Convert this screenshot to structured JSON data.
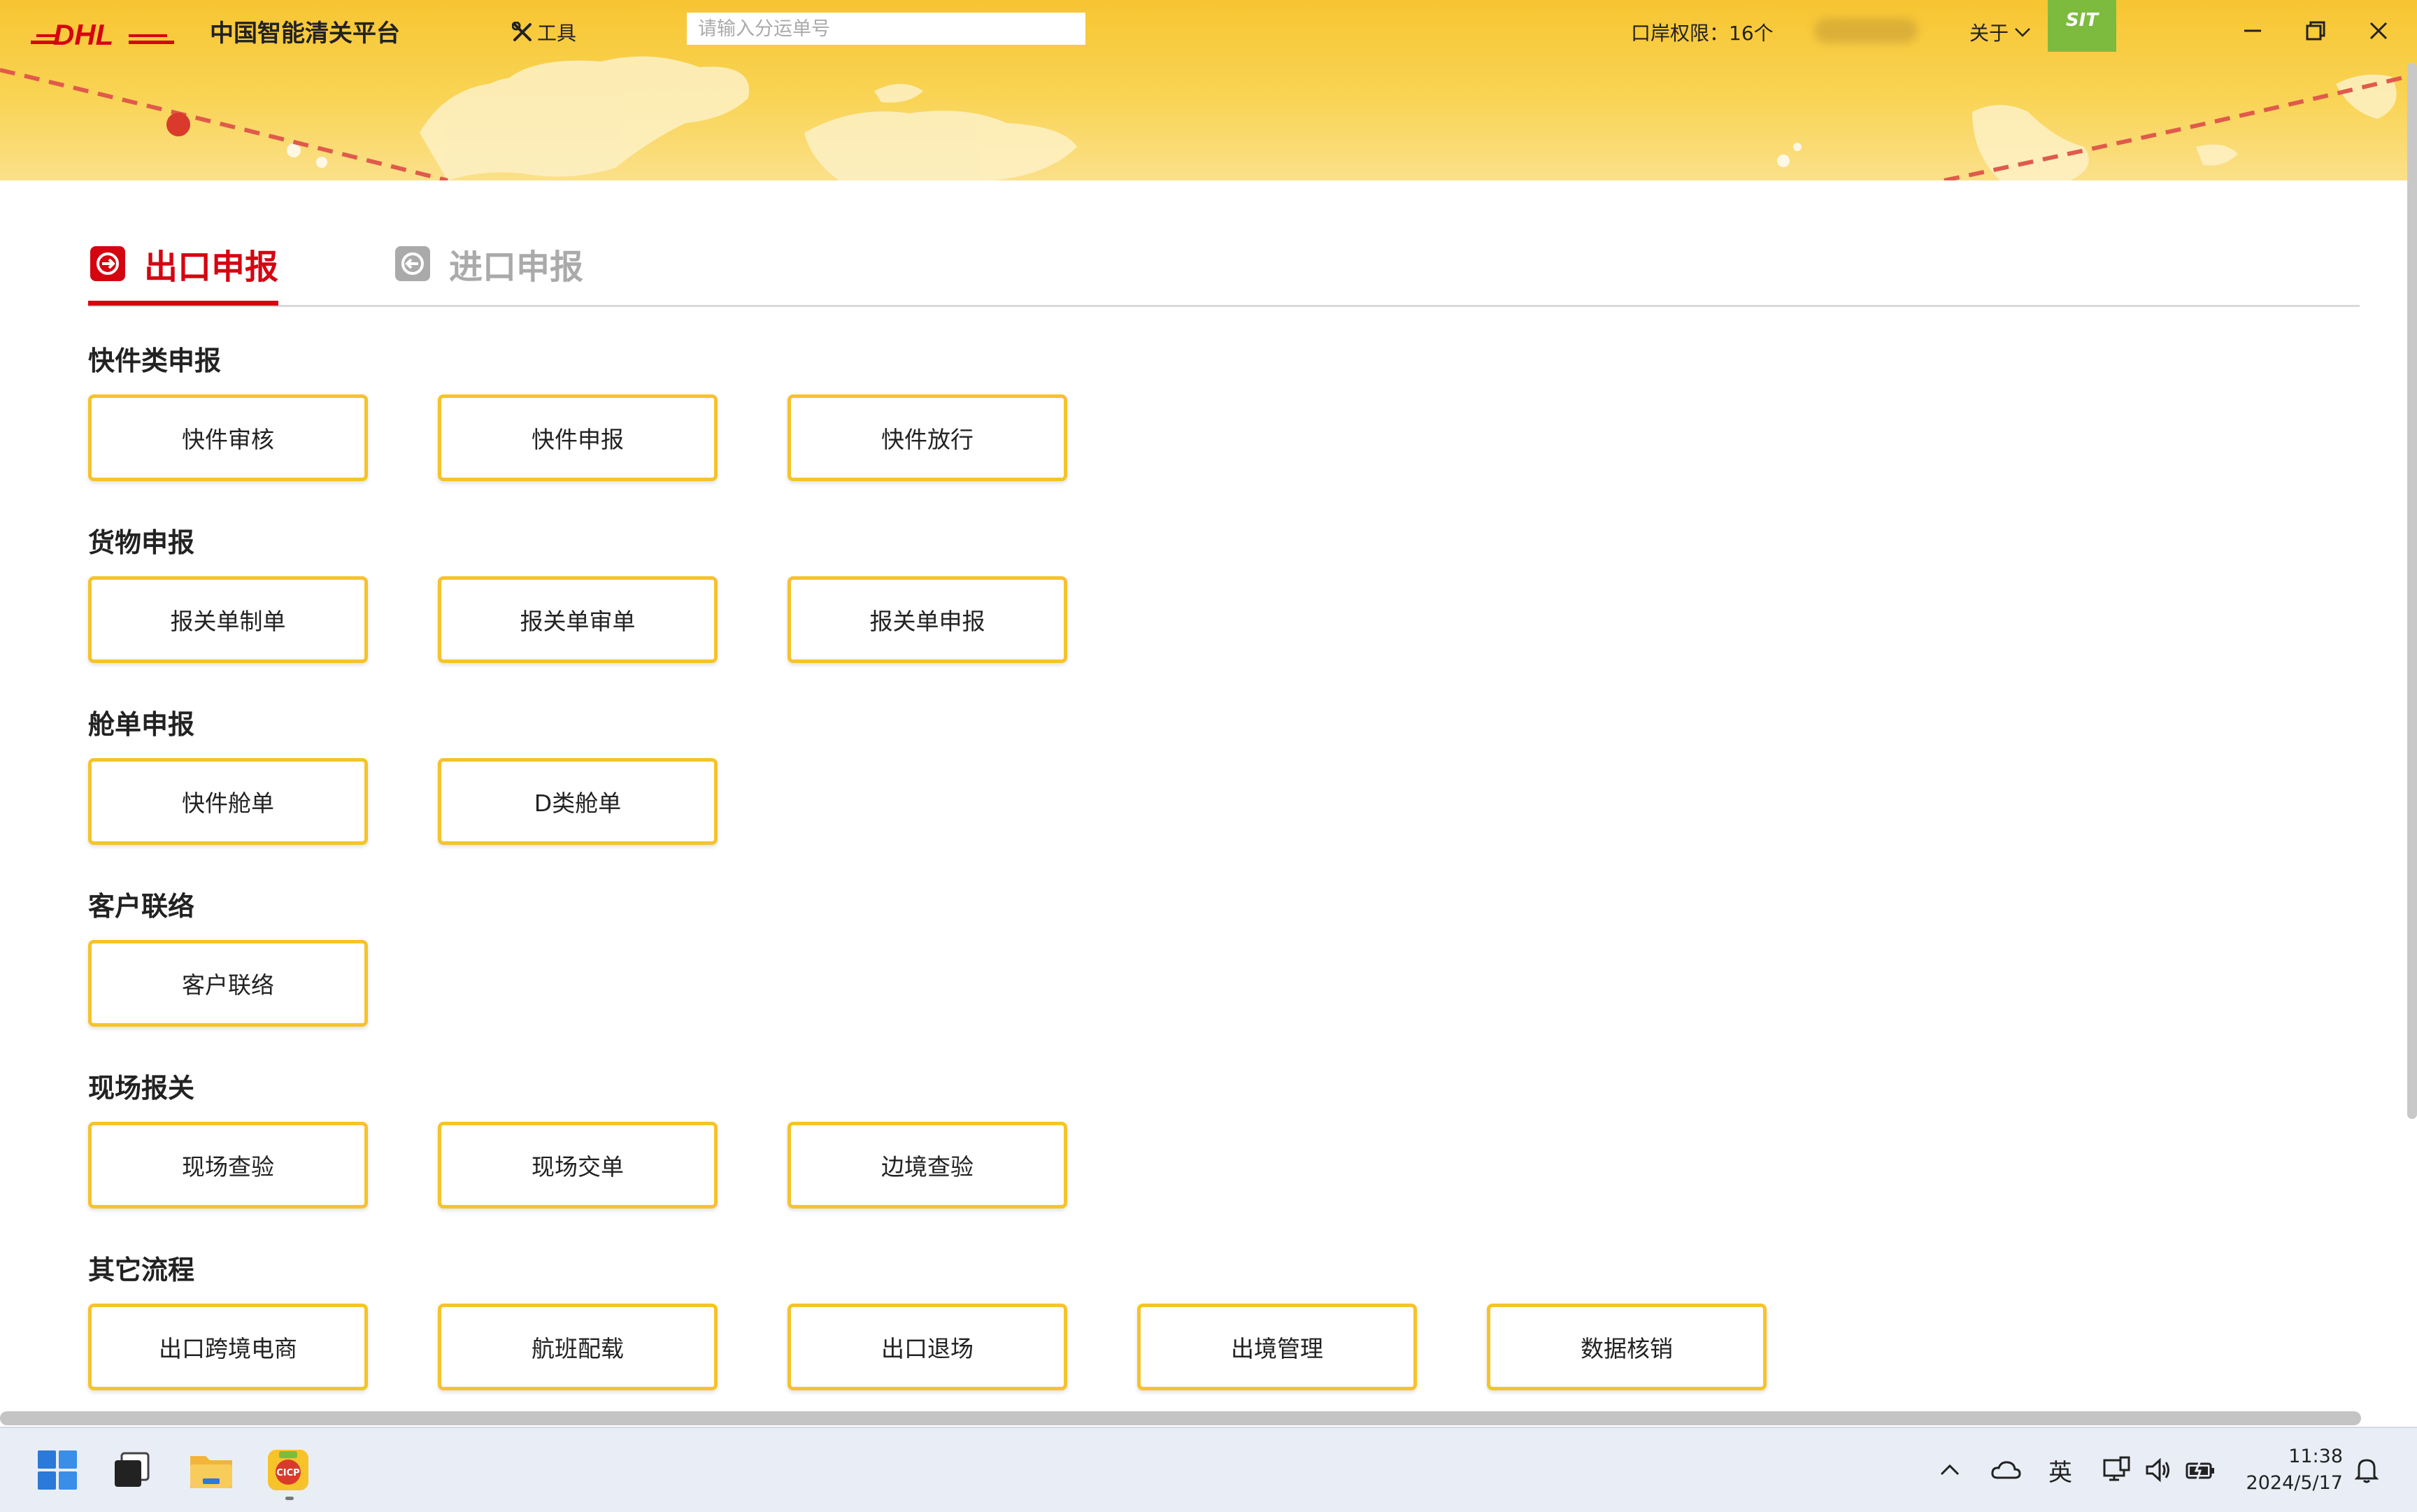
{
  "app": {
    "logo_text": "DHL",
    "title": "中国智能清关平台",
    "env_badge": "SIT"
  },
  "header": {
    "tools_label": "工具",
    "search_placeholder": "请输入分运单号",
    "port_permission": "口岸权限：16个",
    "about_label": "关于"
  },
  "tabs": [
    {
      "label": "出口申报",
      "active": true
    },
    {
      "label": "进口申报",
      "active": false
    }
  ],
  "sections": [
    {
      "title": "快件类申报",
      "buttons": [
        "快件审核",
        "快件申报",
        "快件放行"
      ]
    },
    {
      "title": "货物申报",
      "buttons": [
        "报关单制单",
        "报关单审单",
        "报关单申报"
      ]
    },
    {
      "title": "舱单申报",
      "buttons": [
        "快件舱单",
        "D类舱单"
      ]
    },
    {
      "title": "客户联络",
      "buttons": [
        "客户联络"
      ]
    },
    {
      "title": "现场报关",
      "buttons": [
        "现场查验",
        "现场交单",
        "边境查验"
      ]
    },
    {
      "title": "其它流程",
      "buttons": [
        "出口跨境电商",
        "航班配载",
        "出口退场",
        "出境管理",
        "数据核销"
      ]
    }
  ],
  "taskbar": {
    "ime_label": "英",
    "time": "11:38",
    "date": "2024/5/17"
  },
  "colors": {
    "brand_yellow": "#FFCC00",
    "brand_red": "#D40511",
    "button_border": "#F6C32A",
    "badge_green": "#7DBB3F"
  }
}
